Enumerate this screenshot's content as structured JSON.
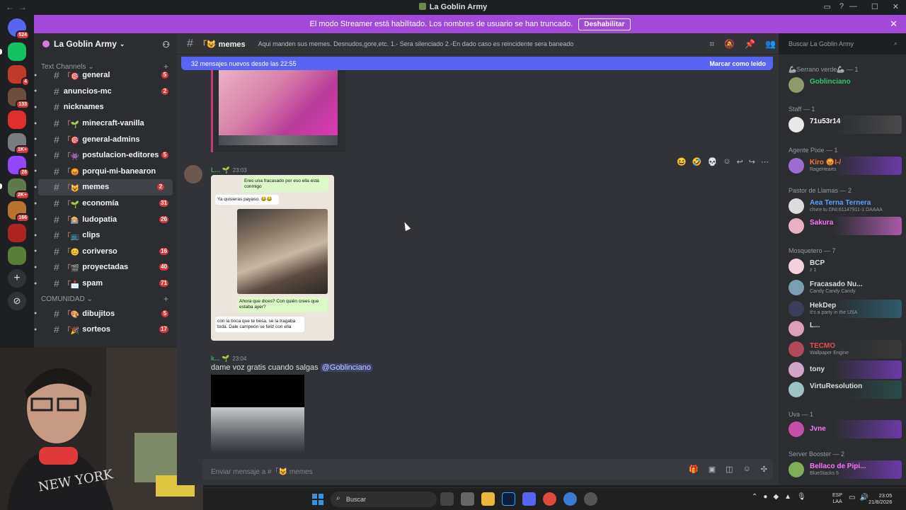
{
  "window": {
    "title": "La Goblin Army"
  },
  "streamer_banner": {
    "text": "El modo Streamer está habilitado. Los nombres de usuario se han truncado.",
    "button": "Deshabilitar"
  },
  "servers": [
    {
      "badge": "524",
      "color": "#5865f2"
    },
    {
      "badge": "",
      "color": "#16c060"
    },
    {
      "badge": "4",
      "color": "#c0392b"
    },
    {
      "badge": "133",
      "color": "#6b4e3d"
    },
    {
      "badge": "",
      "color": "#e02d2d"
    },
    {
      "badge": "1K+",
      "color": "#7a7d80"
    },
    {
      "badge": "28",
      "color": "#9146ff"
    },
    {
      "badge": "2K+",
      "color": "#5f7a4a"
    },
    {
      "badge": "166",
      "color": "#b8742e"
    },
    {
      "badge": "",
      "color": "#b0241f"
    },
    {
      "badge": "",
      "color": "#5b7d3a"
    }
  ],
  "guild": {
    "name": "La Goblin Army"
  },
  "categories": {
    "text": "Text Channels",
    "comunidad": "COMUNIDAD"
  },
  "channels": [
    {
      "name": "general",
      "emoji": "「🎯",
      "count": "5"
    },
    {
      "name": "anuncios-mc",
      "emoji": "",
      "count": "2"
    },
    {
      "name": "nicknames",
      "emoji": "",
      "count": ""
    },
    {
      "name": "minecraft-vanilla",
      "emoji": "「🌱",
      "count": ""
    },
    {
      "name": "general-admins",
      "emoji": "「🎯",
      "count": ""
    },
    {
      "name": "postulacion-editores",
      "emoji": "「👾",
      "count": "5"
    },
    {
      "name": "porqui-mi-banearon",
      "emoji": "「😡",
      "count": ""
    },
    {
      "name": "memes",
      "emoji": "「😺",
      "count": "2"
    },
    {
      "name": "economía",
      "emoji": "「🌱",
      "count": "31"
    },
    {
      "name": "ludopatia",
      "emoji": "「🎰",
      "count": "26"
    },
    {
      "name": "clips",
      "emoji": "「📺",
      "count": ""
    },
    {
      "name": "coriverso",
      "emoji": "「😊",
      "count": "16"
    },
    {
      "name": "proyectadas",
      "emoji": "「🎬",
      "count": "40"
    },
    {
      "name": "spam",
      "emoji": "「📩",
      "count": "71"
    }
  ],
  "comunidad_channels": [
    {
      "name": "dibujitos",
      "emoji": "「🎨",
      "count": "5"
    },
    {
      "name": "sorteos",
      "emoji": "「🎉",
      "count": "17"
    }
  ],
  "channel_header": {
    "name": "memes",
    "emoji": "「😺",
    "topic": "Aqui manden sus memes. Desnudos,gore,etc. 1.- Sera silenciado 2.-En dado caso es reincidente sera baneado"
  },
  "new_messages": {
    "text": "32 mensajes nuevos desde las 22:55",
    "mark": "Marcar como leído"
  },
  "messages": [
    {
      "author": "L...",
      "time": "23:03"
    },
    {
      "author": "k...",
      "time": "23:04",
      "text": "dame voz gratis cuando salgas",
      "mention": "@Goblinciano"
    }
  ],
  "chat_screenshot": {
    "b1": "Eres una fracasado por eso ella está conmigo",
    "b2": "Ya quisieras payaso. 😂😂",
    "b3": "Ahora que dices? Con quién crees que estaba ayer?",
    "b4": "con la boca que te besa, se la tragaba toda. Dale campeón se feliz con ella"
  },
  "composer": {
    "placeholder": "Enviar mensaje a #「😺 memes"
  },
  "search": {
    "placeholder": "Buscar La Goblin Army"
  },
  "member_groups": [
    {
      "label": "🦾Serrano verde🦾 — 1"
    },
    {
      "label": "Staff — 1"
    },
    {
      "label": "Agente Pixie — 1"
    },
    {
      "label": "Pastor de Llamas — 2"
    },
    {
      "label": "Mosquetero — 7"
    },
    {
      "label": "Uva — 1"
    },
    {
      "label": "Server Booster — 2"
    }
  ],
  "members": [
    {
      "name": "Goblinciano",
      "status": "",
      "color": "#2dc770"
    },
    {
      "name": "71u53r14",
      "status": "",
      "color": "#ffffff"
    },
    {
      "name": "Kiro 😡I-/",
      "status": "RageHearts",
      "color": "#f57731"
    },
    {
      "name": "Aea Terna Ternera",
      "status": "chvre tu DNI:61147911-1 DAAAA",
      "color": "#5aa0ff"
    },
    {
      "name": "Sakura",
      "status": "",
      "color": "#ff73fa"
    },
    {
      "name": "BCP",
      "status": "z 1",
      "color": "#dbdee1"
    },
    {
      "name": "Fracasado Nu...",
      "status": "Candy Candy Candy",
      "color": "#dbdee1"
    },
    {
      "name": "HekDep",
      "status": "It's a party in the USA",
      "color": "#dbdee1"
    },
    {
      "name": "L...",
      "status": "",
      "color": "#dbdee1"
    },
    {
      "name": "TECMO",
      "status": "Wallpaper Engine",
      "color": "#e05050"
    },
    {
      "name": "tony",
      "status": "",
      "color": "#dbdee1"
    },
    {
      "name": "VirtuResolution",
      "status": "",
      "color": "#dbdee1"
    },
    {
      "name": "Jvne",
      "status": "",
      "color": "#ff73fa"
    },
    {
      "name": "Bellaco de Pipi...",
      "status": "BlueStacks 5",
      "color": "#ff73fa"
    }
  ],
  "taskbar": {
    "search": "Buscar",
    "lang1": "ESP",
    "lang2": "LAA",
    "time": "23:05",
    "date": "21/8/2026"
  }
}
